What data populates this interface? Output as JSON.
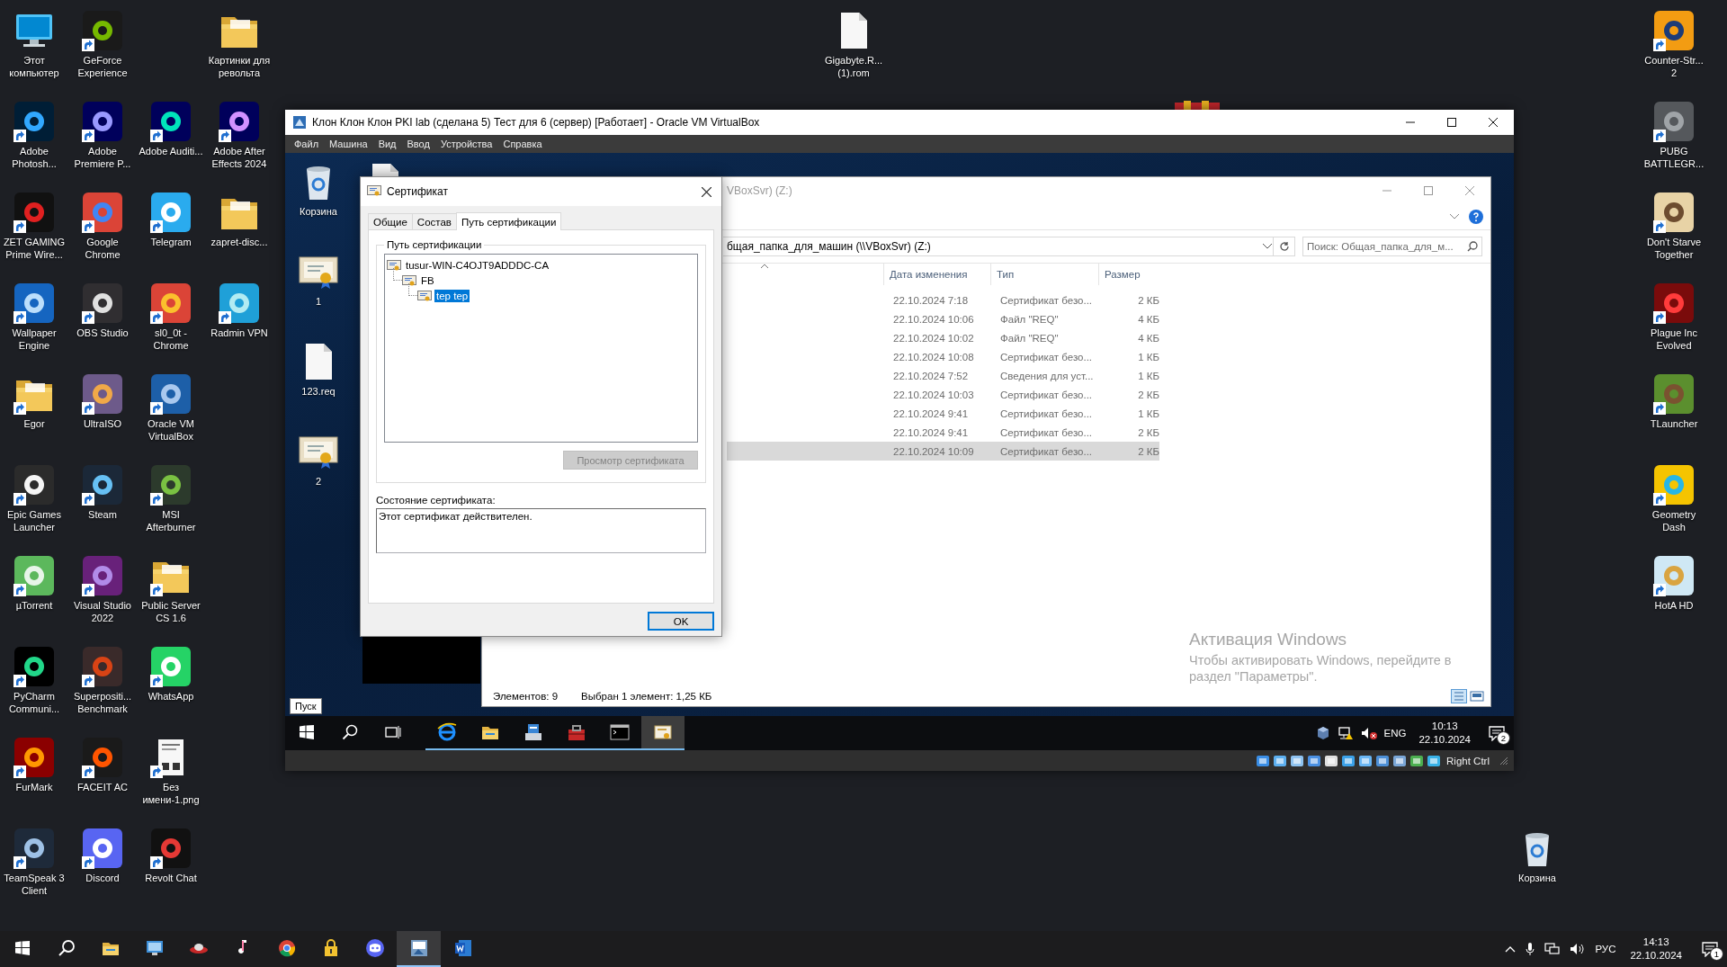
{
  "desktop": {
    "columns": [
      {
        "icons": [
          {
            "label": "Этот компьютер",
            "kind": "computer",
            "shortcut": false
          },
          {
            "label": "Adobe Photosh...",
            "kind": "app",
            "shortcut": true
          },
          {
            "label": "ZET GAMING Prime Wire...",
            "kind": "app",
            "shortcut": true
          },
          {
            "label": "Wallpaper Engine",
            "kind": "app",
            "shortcut": true
          },
          {
            "label": "Egor",
            "kind": "folder",
            "shortcut": true
          },
          {
            "label": "Epic Games Launcher",
            "kind": "app",
            "shortcut": true
          },
          {
            "label": "µTorrent",
            "kind": "app",
            "shortcut": true
          },
          {
            "label": "PyCharm Communi...",
            "kind": "app",
            "shortcut": true
          },
          {
            "label": "FurMark",
            "kind": "app",
            "shortcut": true
          },
          {
            "label": "TeamSpeak 3 Client",
            "kind": "app",
            "shortcut": true
          }
        ]
      },
      {
        "icons": [
          {
            "label": "GeForce Experience",
            "kind": "app",
            "shortcut": true
          },
          {
            "label": "Adobe Premiere P...",
            "kind": "app",
            "shortcut": true
          },
          {
            "label": "Google Chrome",
            "kind": "app",
            "shortcut": true
          },
          {
            "label": "OBS Studio",
            "kind": "app",
            "shortcut": true
          },
          {
            "label": "UltraISO",
            "kind": "app",
            "shortcut": true
          },
          {
            "label": "Steam",
            "kind": "app",
            "shortcut": true
          },
          {
            "label": "Visual Studio 2022",
            "kind": "app",
            "shortcut": true
          },
          {
            "label": "Superpositi... Benchmark",
            "kind": "app",
            "shortcut": true
          },
          {
            "label": "FACEIT AC",
            "kind": "app",
            "shortcut": true
          },
          {
            "label": "Discord",
            "kind": "app",
            "shortcut": true
          }
        ]
      },
      {
        "icons": [
          {
            "label": "Adobe Auditi...",
            "kind": "app",
            "shortcut": true
          },
          {
            "label": "Telegram",
            "kind": "app",
            "shortcut": true
          },
          {
            "label": "sl0_0t - Chrome",
            "kind": "app",
            "shortcut": true
          },
          {
            "label": "Oracle VM VirtualBox",
            "kind": "app",
            "shortcut": true
          },
          {
            "label": "MSI Afterburner",
            "kind": "app",
            "shortcut": true
          },
          {
            "label": "Public Server CS 1.6",
            "kind": "folder",
            "shortcut": true
          },
          {
            "label": "WhatsApp",
            "kind": "app",
            "shortcut": true
          },
          {
            "label": "Без имени-1.png",
            "kind": "document",
            "shortcut": true
          },
          {
            "label": "Revolt Chat",
            "kind": "app",
            "shortcut": true
          }
        ]
      },
      {
        "icons": [
          {
            "label": "Картинки для револьта",
            "kind": "folder",
            "shortcut": false
          },
          {
            "label": "Adobe After Effects 2024",
            "kind": "app",
            "shortcut": true
          },
          {
            "label": "zapret-disc...",
            "kind": "folder",
            "shortcut": false
          },
          {
            "label": "Radmin VPN",
            "kind": "app",
            "shortcut": true
          }
        ]
      }
    ],
    "file": {
      "label": "Gigabyte.R... (1).rom",
      "kind": "file",
      "shortcut": false
    },
    "right_column": [
      {
        "label": "Counter-Str... 2",
        "kind": "app",
        "shortcut": true
      },
      {
        "label": "PUBG BATTLEGR...",
        "kind": "app",
        "shortcut": true
      },
      {
        "label": "Don't Starve Together",
        "kind": "app",
        "shortcut": true
      },
      {
        "label": "Plague Inc Evolved",
        "kind": "app",
        "shortcut": true
      },
      {
        "label": "TLauncher",
        "kind": "app",
        "shortcut": true
      },
      {
        "label": "Geometry Dash",
        "kind": "app",
        "shortcut": true
      },
      {
        "label": "HotA HD",
        "kind": "app",
        "shortcut": true
      }
    ],
    "recycle_bin": {
      "label": "Корзина",
      "kind": "recycle-bin",
      "shortcut": false
    }
  },
  "virtualbox": {
    "title": "Клон Клон Клон PKI lab (сделана 5) Тест для 6 (сервер) [Работает] - Oracle VM VirtualBox",
    "menu": [
      "Файл",
      "Машина",
      "Вид",
      "Ввод",
      "Устройства",
      "Справка"
    ],
    "guest": {
      "desktop_icons": [
        {
          "label": "Корзина",
          "kind": "recycle-bin"
        },
        {
          "kind": "file"
        },
        {
          "label": "1",
          "kind": "certificate"
        },
        {
          "label": "123.req",
          "kind": "file"
        },
        {
          "label": "2",
          "kind": "certificate"
        }
      ],
      "certificate_dialog": {
        "title": "Сертификат",
        "tabs": [
          {
            "label": "Общие",
            "selected": false
          },
          {
            "label": "Состав",
            "selected": false
          },
          {
            "label": "Путь сертификации",
            "selected": true
          }
        ],
        "group_label": "Путь сертификации",
        "path_tree": [
          {
            "label": "tusur-WIN-C4OJT9ADDDC-CA",
            "selected": false,
            "children": [
              {
                "label": "FB",
                "selected": false,
                "children": [
                  {
                    "label": "tep tep",
                    "selected": true
                  }
                ]
              }
            ]
          }
        ],
        "view_button": {
          "label": "Просмотр сертификата",
          "disabled": true
        },
        "status_label": "Состояние сертификата:",
        "status_text": "Этот сертификат действителен.",
        "ok_button": "OK"
      },
      "explorer": {
        "title": "VBoxSvr) (Z:)",
        "address": "бщая_папка_для_машин (\\\\VBoxSvr) (Z:)",
        "search": {
          "placeholder": "Поиск: Общая_папка_для_м..."
        },
        "columns": [
          "Дата изменения",
          "Тип",
          "Размер"
        ],
        "rows": [
          {
            "modified": "22.10.2024 7:18",
            "type": "Сертификат безо...",
            "size": "2 КБ",
            "selected": false
          },
          {
            "modified": "22.10.2024 10:06",
            "type": "Файл \"REQ\"",
            "size": "4 КБ",
            "selected": false
          },
          {
            "modified": "22.10.2024 10:02",
            "type": "Файл \"REQ\"",
            "size": "4 КБ",
            "selected": false
          },
          {
            "modified": "22.10.2024 10:08",
            "type": "Сертификат безо...",
            "size": "1 КБ",
            "selected": false
          },
          {
            "modified": "22.10.2024 7:52",
            "type": "Сведения для уст...",
            "size": "1 КБ",
            "selected": false
          },
          {
            "modified": "22.10.2024 10:03",
            "type": "Сертификат безо...",
            "size": "2 КБ",
            "selected": false
          },
          {
            "modified": "22.10.2024 9:41",
            "type": "Сертификат безо...",
            "size": "1 КБ",
            "selected": false
          },
          {
            "modified": "22.10.2024 9:41",
            "type": "Сертификат безо...",
            "size": "2 КБ",
            "selected": false
          },
          {
            "modified": "22.10.2024 10:09",
            "type": "Сертификат безо...",
            "size": "2 КБ",
            "selected": true
          }
        ],
        "status": {
          "items": "Элементов: 9",
          "selection": "Выбран 1 элемент: 1,25 КБ"
        }
      },
      "activation": {
        "title": "Активация Windows",
        "text": "Чтобы активировать Windows, перейдите в раздел \"Параметры\"."
      },
      "start_tooltip": "Пуск",
      "taskbar": {
        "apps": [
          {
            "selected": false,
            "running": true
          },
          {
            "selected": false,
            "running": true
          },
          {
            "selected": false,
            "running": true
          },
          {
            "selected": false,
            "running": true
          },
          {
            "selected": false,
            "running": true
          },
          {
            "selected": true,
            "running": true
          }
        ],
        "language": "ENG",
        "time": "10:13",
        "date": "22.10.2024",
        "notifications": "2"
      }
    },
    "status_bar": {
      "host_key": "Right Ctrl"
    }
  },
  "taskbar": {
    "apps": [
      {
        "selected": false
      },
      {
        "selected": false
      },
      {
        "selected": false
      },
      {
        "selected": false
      },
      {
        "selected": false
      },
      {
        "selected": false
      },
      {
        "selected": false
      },
      {
        "selected": true
      },
      {
        "selected": false
      }
    ],
    "language": "РУС",
    "time": "14:13",
    "date": "22.10.2024",
    "notifications": "1"
  }
}
